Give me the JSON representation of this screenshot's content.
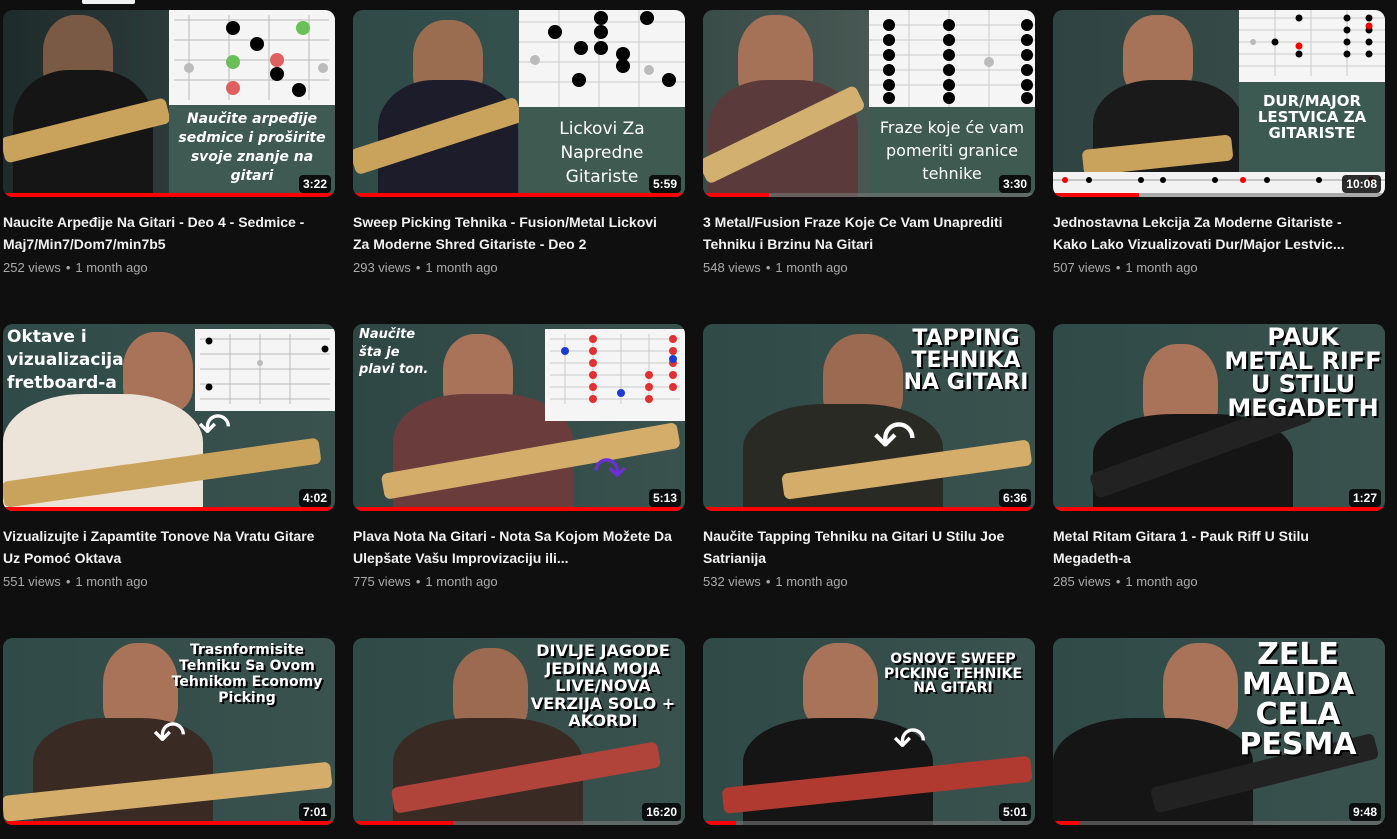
{
  "tab_indicator": "",
  "videos": [
    {
      "title": "Naucite Arpeđije Na Gitari - Deo 4 - Sedmice - Maj7/Min7/Dom7/min7b5",
      "views": "252 views",
      "age": "1 month ago",
      "duration": "3:22",
      "overlay": "Naučite arpeđije sedmice i proširite svoje znanje na gitari",
      "progress": 1.0
    },
    {
      "title": "Sweep Picking Tehnika - Fusion/Metal Lickovi Za Moderne Shred Gitariste - Deo 2",
      "views": "293 views",
      "age": "1 month ago",
      "duration": "5:59",
      "overlay": "Lickovi Za Napredne Gitariste",
      "progress": 1.0
    },
    {
      "title": "3 Metal/Fusion Fraze Koje Ce Vam Unaprediti Tehniku i Brzinu Na Gitari",
      "views": "548 views",
      "age": "1 month ago",
      "duration": "3:30",
      "overlay": "Fraze koje će vam pomeriti granice tehnike",
      "progress": 0.2
    },
    {
      "title": "Jednostavna Lekcija Za Moderne Gitariste - Kako Lako Vizualizovati Dur/Major Lestvic...",
      "views": "507 views",
      "age": "1 month ago",
      "duration": "10:08",
      "overlay": "DUR/MAJOR LESTVICA ZA GITARISTE",
      "progress": 0.26
    },
    {
      "title": "Vizualizujte i Zapamtite Tonove Na Vratu Gitare Uz Pomoć Oktava",
      "views": "551 views",
      "age": "1 month ago",
      "duration": "4:02",
      "overlay": "Oktave i vizualizacija fretboard-a",
      "progress": 1.0
    },
    {
      "title": "Plava Nota Na Gitari - Nota Sa Kojom Možete Da Ulepšate Vašu Improvizaciju ili...",
      "views": "775 views",
      "age": "1 month ago",
      "duration": "5:13",
      "overlay": "Naučite šta je plavi ton.",
      "progress": 1.0
    },
    {
      "title": "Naučite Tapping Tehniku na Gitari U Stilu Joe Satrianija",
      "views": "532 views",
      "age": "1 month ago",
      "duration": "6:36",
      "overlay": "TAPPING TEHNIKA NA GITARI",
      "progress": 1.0
    },
    {
      "title": "Metal Ritam Gitara 1 - Pauk Riff U Stilu Megadeth-a",
      "views": "285 views",
      "age": "1 month ago",
      "duration": "1:27",
      "overlay": "PAUK METAL RIFF U STILU MEGADETH",
      "progress": 1.0
    },
    {
      "title": "",
      "views": "",
      "age": "",
      "duration": "7:01",
      "overlay": "Trasnformisite Tehniku Sa Ovom Tehnikom Economy Picking",
      "progress": 1.0
    },
    {
      "title": "",
      "views": "",
      "age": "",
      "duration": "16:20",
      "overlay": "DIVLJE JAGODE JEDINA MOJA LIVE/NOVA VERZIJA SOLO + AKORDI",
      "progress": 0.3
    },
    {
      "title": "",
      "views": "",
      "age": "",
      "duration": "5:01",
      "overlay": "OSNOVE SWEEP PICKING TEHNIKE NA GITARI",
      "progress": 0.1
    },
    {
      "title": "",
      "views": "",
      "age": "",
      "duration": "9:48",
      "overlay": "ZELE MAIDA CELA PESMA",
      "progress": 0.08
    }
  ],
  "colors": {
    "background": "#0f0f0f",
    "progress": "#ff0000",
    "meta_text": "#aaaaaa",
    "title_text": "#f1f1f1"
  }
}
